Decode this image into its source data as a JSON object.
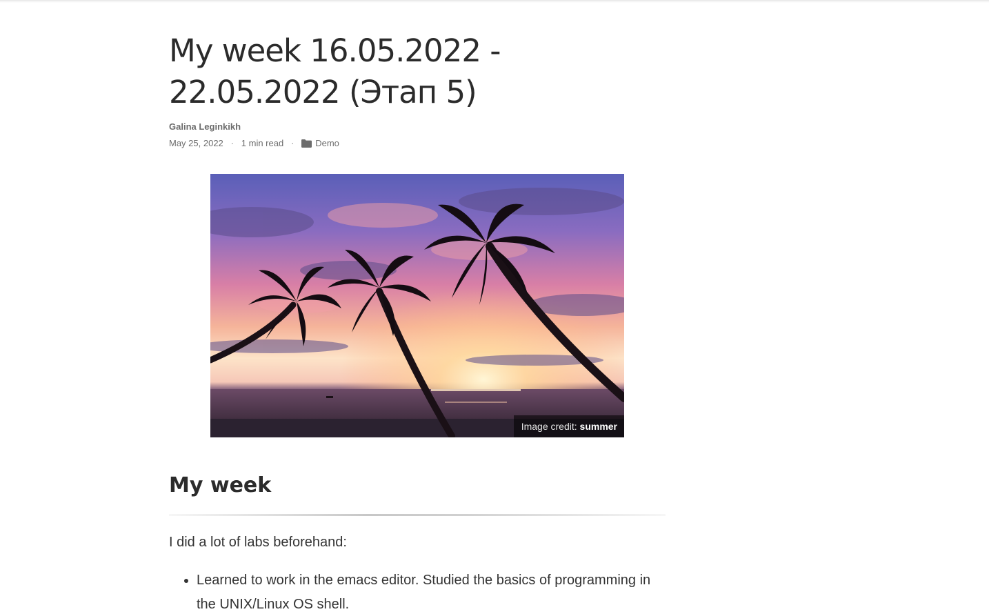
{
  "post": {
    "title_line1": "My week 16.05.2022 -",
    "title_line2": "22.05.2022 (Этап 5)",
    "author": "Galina Leginkikh",
    "date": "May 25, 2022",
    "separator": "·",
    "read_time": "1 min read",
    "category": "Demo",
    "category_icon": "folder-icon"
  },
  "hero": {
    "credit_prefix": "Image credit:",
    "credit_name": "summer"
  },
  "content": {
    "heading": "My week",
    "intro": "I did a lot of labs beforehand:",
    "list_items": [
      "Learned to work in the emacs editor. Studied the basics of programming in the UNIX/Linux OS shell."
    ]
  }
}
